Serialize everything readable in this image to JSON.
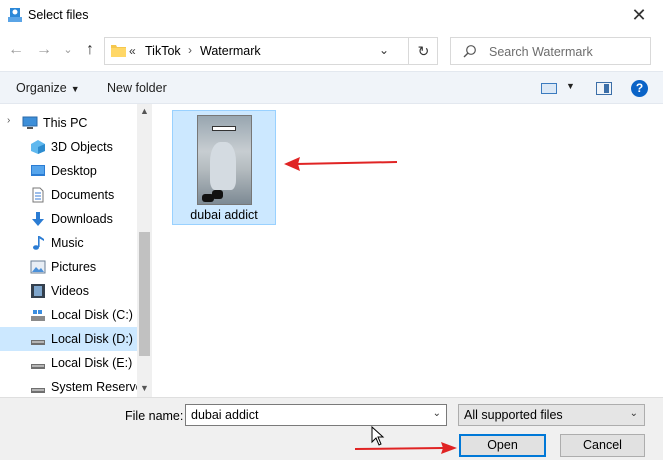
{
  "window": {
    "title": "Select files",
    "close_glyph": "✕",
    "icon": "file-dialog-icon"
  },
  "navigation": {
    "back_glyph": "←",
    "forward_glyph": "→",
    "recent_glyph": "⌄",
    "up_glyph": "↑",
    "breadcrumb_more": "«",
    "breadcrumbs": [
      "TikTok",
      "Watermark"
    ],
    "separator": "›",
    "dropdown_glyph": "⌄",
    "refresh_glyph": "↻",
    "search_placeholder": "Search Watermark"
  },
  "commandbar": {
    "organize_label": "Organize",
    "organize_drop": "▼",
    "new_folder_label": "New folder",
    "view_drop": "▼",
    "help_label": "?"
  },
  "nav_pane": {
    "items": [
      {
        "label": "This PC",
        "icon": "pc-icon",
        "arrow": "›"
      },
      {
        "label": "3D Objects",
        "icon": "3d-objects-icon"
      },
      {
        "label": "Desktop",
        "icon": "desktop-icon"
      },
      {
        "label": "Documents",
        "icon": "documents-icon"
      },
      {
        "label": "Downloads",
        "icon": "downloads-icon"
      },
      {
        "label": "Music",
        "icon": "music-icon"
      },
      {
        "label": "Pictures",
        "icon": "pictures-icon"
      },
      {
        "label": "Videos",
        "icon": "videos-icon"
      },
      {
        "label": "Local Disk (C:)",
        "icon": "drive-icon"
      },
      {
        "label": "Local Disk (D:)",
        "icon": "drive-icon",
        "selected": true
      },
      {
        "label": "Local Disk (E:)",
        "icon": "drive-icon"
      },
      {
        "label": "System Reserved",
        "icon": "drive-icon"
      }
    ],
    "scroll_up": "▲",
    "scroll_down": "▼"
  },
  "files": [
    {
      "name": "dubai addict",
      "type": "video-thumbnail",
      "selected": true
    }
  ],
  "footer": {
    "file_name_label": "File name:",
    "file_name_value": "dubai addict",
    "file_name_drop": "⌄",
    "filter_value": "All supported files",
    "filter_drop": "⌄",
    "open_label": "Open",
    "cancel_label": "Cancel"
  },
  "colors": {
    "annotation_arrow": "#e02424",
    "selection": "#cce8ff",
    "accent": "#0078d7"
  }
}
